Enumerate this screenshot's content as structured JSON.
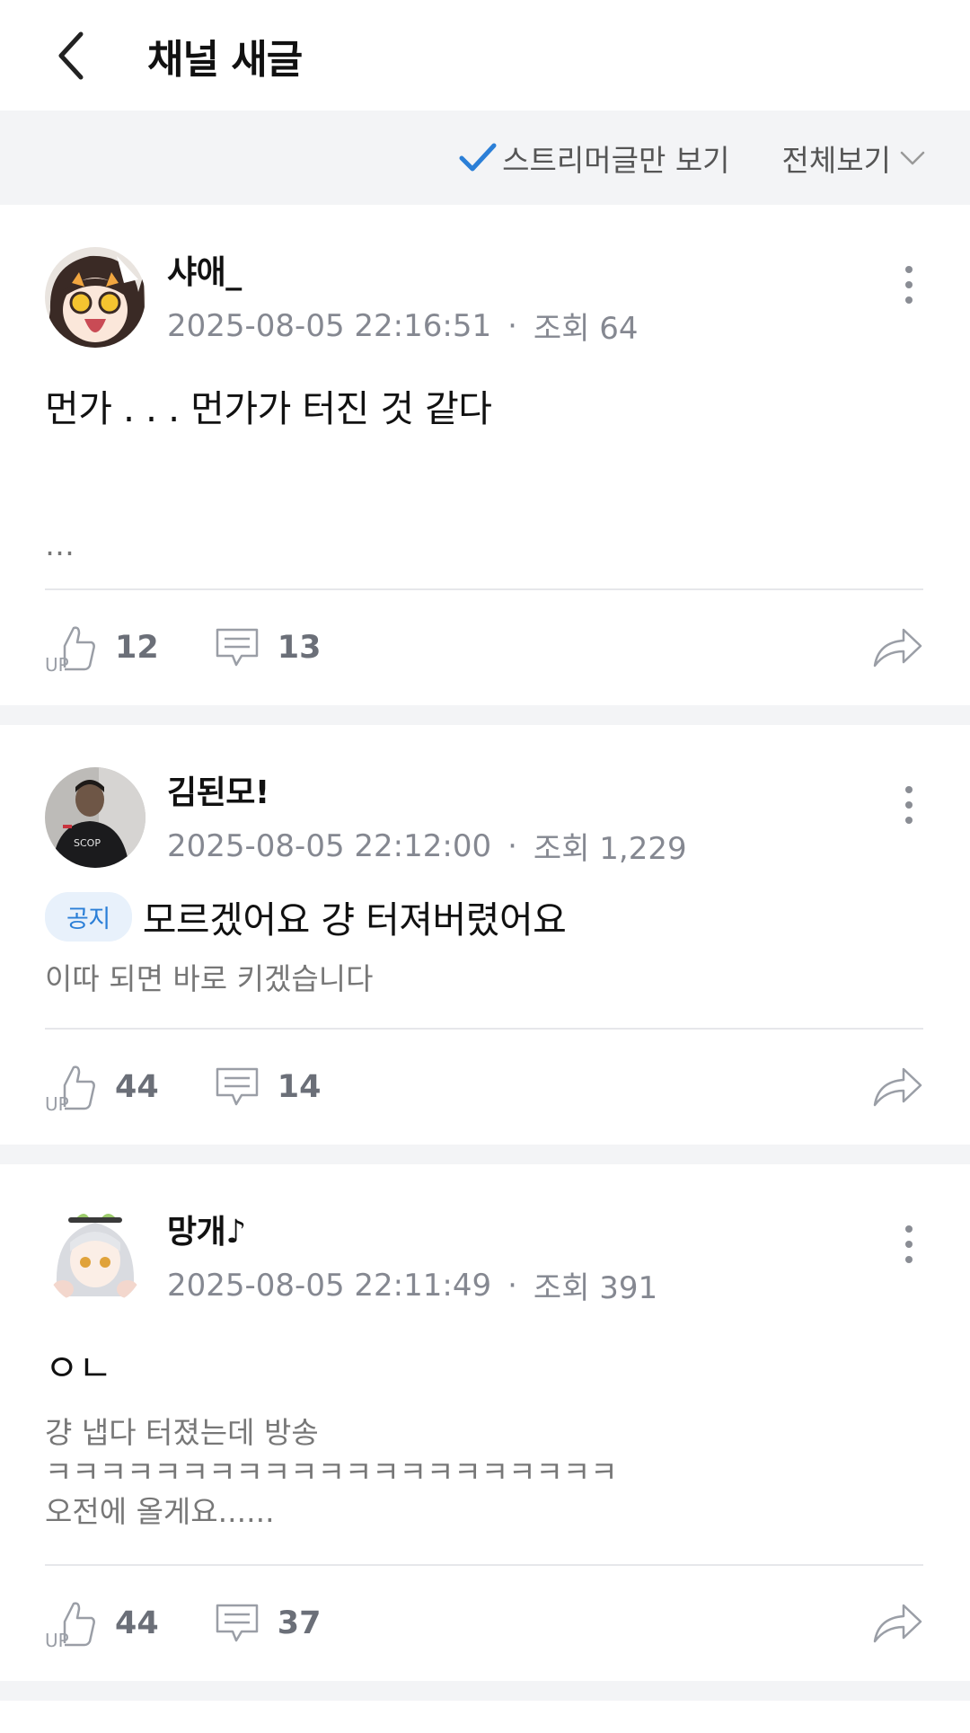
{
  "header": {
    "title": "채널 새글",
    "back_icon": "chevron-left-icon"
  },
  "filters": {
    "streamer_only_label": "스트리머글만 보기",
    "streamer_only_checked": true,
    "view_all_label": "전체보기"
  },
  "colors": {
    "accent": "#2b7fd7",
    "muted": "#858891",
    "separator": "#f3f4f6"
  },
  "posts": [
    {
      "author": "샤애_",
      "date": "2025-08-05 22:16:51",
      "dot": "·",
      "views": "조회 64",
      "title": "먼가 . . . 먼가가 터진 것 같다",
      "notice": "",
      "body": "\n\n…",
      "likes": "12",
      "comments": "13"
    },
    {
      "author": "김된모!",
      "date": "2025-08-05 22:12:00",
      "dot": "·",
      "views": "조회 1,229",
      "title": "모르겠어요 걍 터져버렸어요",
      "notice": "공지",
      "body": "이따 되면 바로 키겠습니다",
      "likes": "44",
      "comments": "14"
    },
    {
      "author": "망개♪",
      "date": "2025-08-05 22:11:49",
      "dot": "·",
      "views": "조회 391",
      "title": "ㅇㄴ",
      "notice": "",
      "body": "걍 냅다 터졌는데 방송\nㅋㅋㅋㅋㅋㅋㅋㅋㅋㅋㅋㅋㅋㅋㅋㅋㅋㅋㅋㅋㅋ\n오전에 올게요......",
      "likes": "44",
      "comments": "37"
    }
  ]
}
